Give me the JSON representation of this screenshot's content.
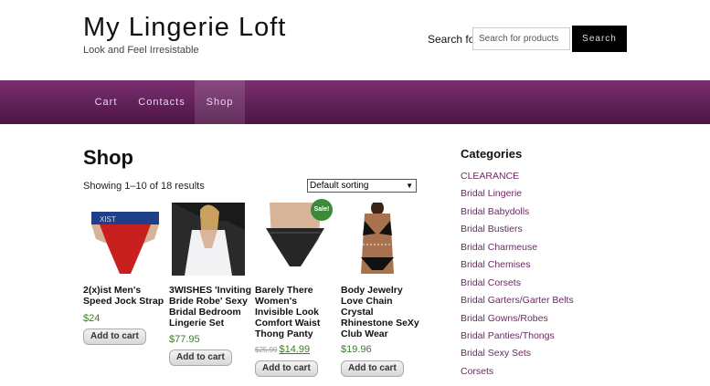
{
  "site": {
    "title": "My Lingerie Loft",
    "tagline": "Look and Feel Irresistable"
  },
  "search": {
    "label": "Search for:",
    "placeholder": "Search for products",
    "button_label": "Search"
  },
  "nav": {
    "items": [
      {
        "label": "Cart",
        "active": false
      },
      {
        "label": "Contacts",
        "active": false
      },
      {
        "label": "Shop",
        "active": true
      }
    ]
  },
  "main": {
    "page_title": "Shop",
    "result_count": "Showing 1–10 of 18 results",
    "sorting_selected": "Default sorting"
  },
  "products": [
    {
      "name": "2(x)ist Men's Speed Jock Strap",
      "price": "$24",
      "button_label": "Add to cart"
    },
    {
      "name": "3WISHES 'Inviting Bride Robe' Sexy Bridal Bedroom Lingerie Set",
      "price": "$77.95",
      "button_label": "Add to cart"
    },
    {
      "name": "Barely There Women's Invisible Look Comfort Waist Thong Panty",
      "old_price": "$25.99",
      "price": "$14.99",
      "sale_badge": "Sale!",
      "button_label": "Add to cart"
    },
    {
      "name": "Body Jewelry Love Chain Crystal Rhinestone SeXy Club Wear",
      "price": "$19.96",
      "button_label": "Add to cart"
    }
  ],
  "sidebar": {
    "title": "Categories",
    "items": [
      {
        "label": "CLEARANCE"
      },
      {
        "label": "Bridal Lingerie"
      },
      {
        "label": "Bridal Babydolls"
      },
      {
        "label": "Bridal Bustiers"
      },
      {
        "label": "Bridal Charmeuse"
      },
      {
        "label": "Bridal Chemises"
      },
      {
        "label": "Bridal Corsets"
      },
      {
        "label": "Bridal Garters/Garter Belts"
      },
      {
        "label": "Bridal Gowns/Robes"
      },
      {
        "label": "Bridal Panties/Thongs"
      },
      {
        "label": "Bridal Sexy Sets"
      },
      {
        "label": "Corsets"
      }
    ]
  },
  "colors": {
    "nav_top": "#7a2f6f",
    "nav_bottom": "#4c1546",
    "link": "#6a2a62",
    "price": "#3a7d2a"
  }
}
